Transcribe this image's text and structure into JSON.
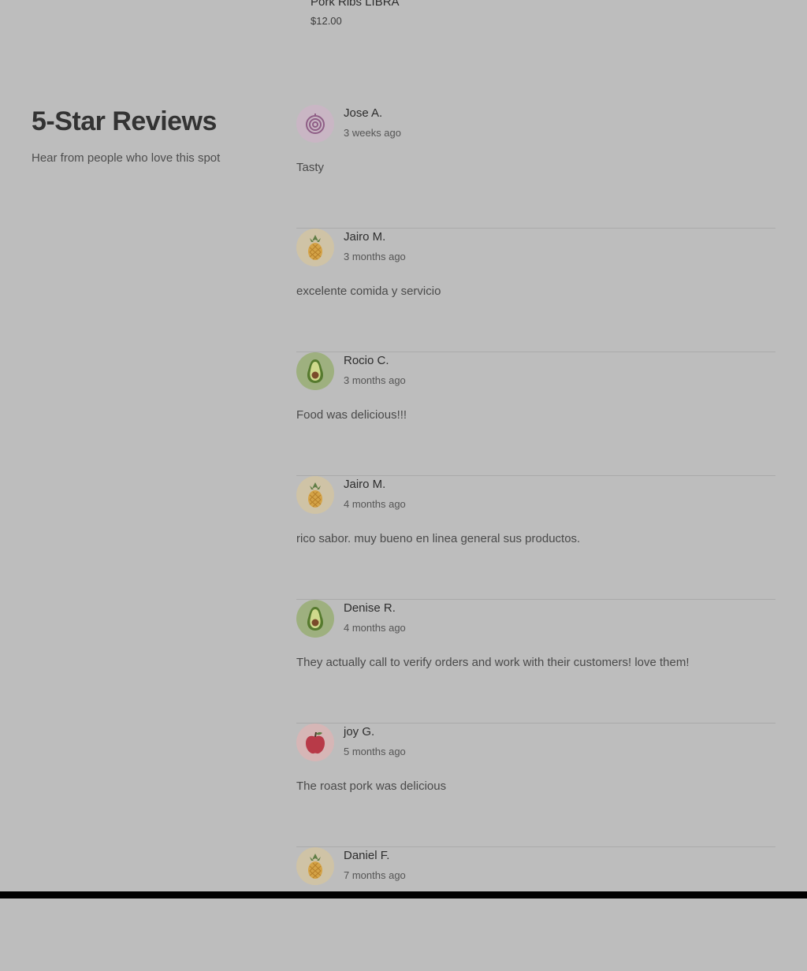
{
  "menu_item": {
    "name": "Pork Ribs LIBRA",
    "price": "$12.00"
  },
  "section": {
    "title": "5-Star Reviews",
    "subtitle": "Hear from people who love this spot"
  },
  "reviews": [
    {
      "name": "Jose A.",
      "date": "3 weeks ago",
      "text": "Tasty",
      "avatar_icon": "onion-icon",
      "avatar_bg": "#c9b6c4"
    },
    {
      "name": "Jairo M.",
      "date": "3 months ago",
      "text": "excelente comida y servicio",
      "avatar_icon": "pineapple-icon",
      "avatar_bg": "#cfc3a6"
    },
    {
      "name": "Rocio C.",
      "date": "3 months ago",
      "text": "Food was delicious!!!",
      "avatar_icon": "avocado-icon",
      "avatar_bg": "#9eb07f"
    },
    {
      "name": "Jairo M.",
      "date": "4 months ago",
      "text": "rico sabor. muy bueno en linea general sus productos.",
      "avatar_icon": "pineapple-icon",
      "avatar_bg": "#cfc3a6"
    },
    {
      "name": "Denise R.",
      "date": "4 months ago",
      "text": "They actually call to verify orders and work with their customers! love them!",
      "avatar_icon": "avocado-icon",
      "avatar_bg": "#9eb07f"
    },
    {
      "name": "joy G.",
      "date": "5 months ago",
      "text": "The roast pork was delicious",
      "avatar_icon": "apple-icon",
      "avatar_bg": "#d6b6b6"
    },
    {
      "name": "Daniel F.",
      "date": "7 months ago",
      "text": "",
      "avatar_icon": "pineapple-icon",
      "avatar_bg": "#cfc3a6"
    }
  ]
}
